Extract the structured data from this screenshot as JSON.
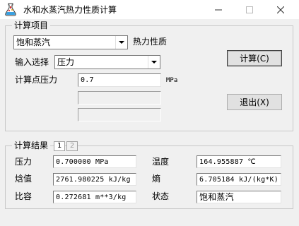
{
  "window": {
    "title": "水和水蒸汽热力性质计算",
    "app_icon": "flask-icon"
  },
  "calc_items": {
    "legend": "计算项目",
    "property_select": {
      "value": "饱和蒸汽"
    },
    "property_label": "热力性质",
    "input_select_label": "输入选择",
    "input_select": {
      "value": "压力"
    },
    "point_label": "计算点压力",
    "point_value": "0.7",
    "point_unit": "MPa",
    "input2_value": "",
    "input3_value": ""
  },
  "buttons": {
    "calc": "计算(C)",
    "exit": "退出(X)"
  },
  "results": {
    "legend": "计算结果",
    "pages": [
      "1",
      "2"
    ],
    "active_page": "1",
    "rows": [
      {
        "label": "压力",
        "value": "0.700000 MPa",
        "label2": "温度",
        "value2": "164.955887 ℃"
      },
      {
        "label": "焓值",
        "value": "2761.980225 kJ/kg",
        "label2": "熵",
        "value2": "6.705184 kJ/(kg*K)"
      },
      {
        "label": "比容",
        "value": "0.272681 m**3/kg",
        "label2": "状态",
        "value2": "饱和蒸汽"
      }
    ]
  },
  "colors": {
    "window_bg": "#f0f0f0",
    "field_bg": "#ffffff",
    "border": "#7a7a7a"
  }
}
